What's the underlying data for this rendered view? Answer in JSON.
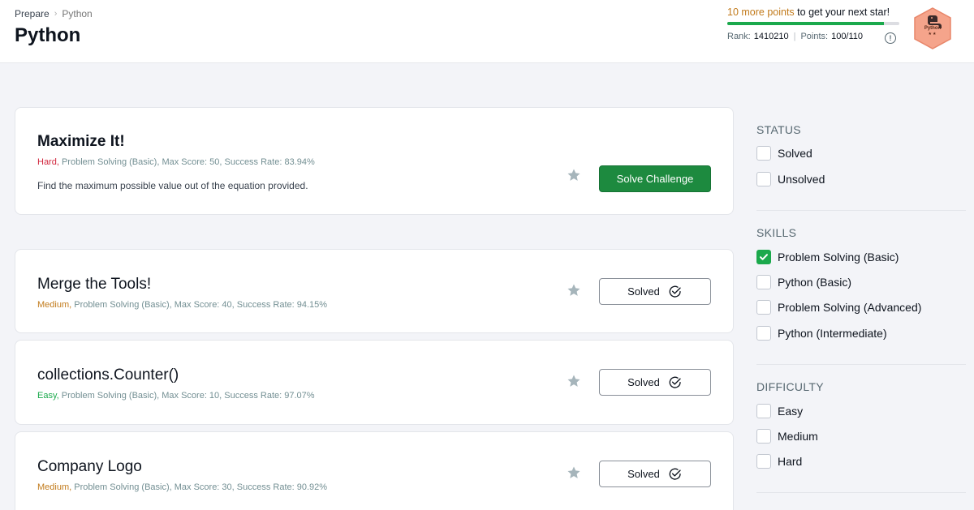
{
  "breadcrumb": {
    "root": "Prepare",
    "current": "Python"
  },
  "page_title": "Python",
  "progress": {
    "points_text": "10 more points",
    "rest_text": "to get your next star!",
    "fill_fraction": 0.909,
    "rank_label": "Rank:",
    "rank_value": "1410210",
    "points_label": "Points:",
    "points_value": "100/110"
  },
  "badge": {
    "label": "Python",
    "stars": "★★"
  },
  "challenges": [
    {
      "title": "Maximize It!",
      "difficulty": "Hard,",
      "meta": "Problem Solving (Basic), Max Score: 50, Success Rate: 83.94%",
      "description": "Find the maximum possible value out of the equation provided.",
      "button": "Solve Challenge"
    },
    {
      "title": "Merge the Tools!",
      "difficulty": "Medium,",
      "meta": "Problem Solving (Basic), Max Score: 40, Success Rate: 94.15%",
      "button": "Solved"
    },
    {
      "title": "collections.Counter()",
      "difficulty": "Easy,",
      "meta": "Problem Solving (Basic), Max Score: 10, Success Rate: 97.07%",
      "button": "Solved"
    },
    {
      "title": "Company Logo",
      "difficulty": "Medium,",
      "meta": "Problem Solving (Basic), Max Score: 30, Success Rate: 90.92%",
      "button": "Solved"
    }
  ],
  "filters": {
    "status": {
      "heading": "STATUS",
      "options": [
        "Solved",
        "Unsolved"
      ]
    },
    "skills": {
      "heading": "SKILLS",
      "options": [
        "Problem Solving (Basic)",
        "Python (Basic)",
        "Problem Solving (Advanced)",
        "Python (Intermediate)"
      ]
    },
    "difficulty": {
      "heading": "DIFFICULTY",
      "options": [
        "Easy",
        "Medium",
        "Hard"
      ]
    }
  },
  "colors": {
    "accent_green": "#1ba94c",
    "button_green": "#1d8a3f",
    "hard": "#d1283e",
    "medium": "#c27b1c",
    "easy": "#1ba94c"
  },
  "icons": [
    "chevron-right-icon",
    "info-icon",
    "python-badge-icon",
    "star-icon",
    "check-circle-icon",
    "checkmark-icon"
  ]
}
